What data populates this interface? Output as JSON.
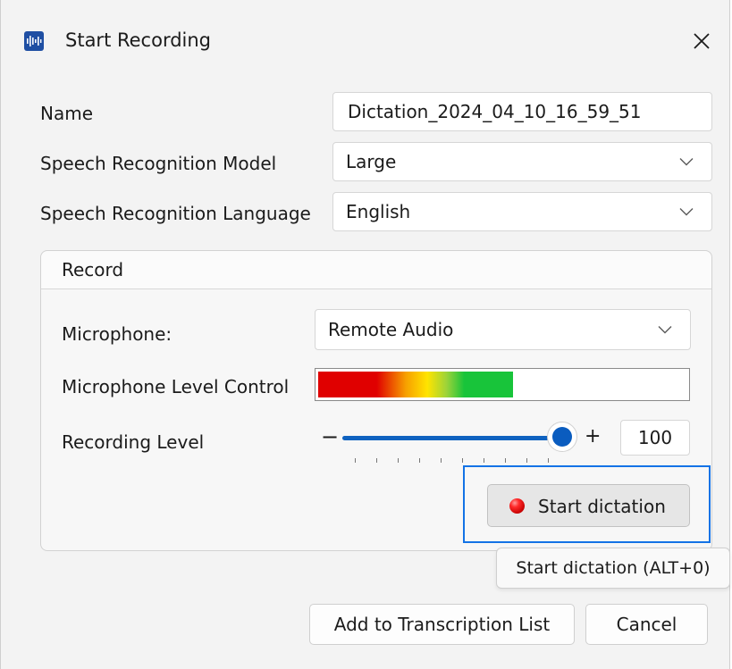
{
  "window": {
    "title": "Start Recording",
    "app_icon": "waveform-icon",
    "close_icon": "close-icon"
  },
  "form": {
    "name_label": "Name",
    "name_value": "Dictation_2024_04_10_16_59_51",
    "model_label": "Speech Recognition Model",
    "model_value": "Large",
    "language_label": "Speech Recognition Language",
    "language_value": "English"
  },
  "record_group": {
    "title": "Record",
    "microphone_label": "Microphone:",
    "microphone_value": "Remote Audio",
    "level_control_label": "Microphone Level Control",
    "level_fill_fraction": 0.53,
    "recording_level_label": "Recording Level",
    "slider_minus": "−",
    "slider_plus": "+",
    "recording_level_value": "100",
    "start_button_label": "Start dictation"
  },
  "tooltip": {
    "text": "Start dictation (ALT+0)"
  },
  "footer": {
    "add_button_label": "Add to Transcription List",
    "cancel_button_label": "Cancel"
  },
  "colors": {
    "accent": "#0a5cbf",
    "focus_ring": "#1473e6",
    "record_red": "#e00000"
  }
}
